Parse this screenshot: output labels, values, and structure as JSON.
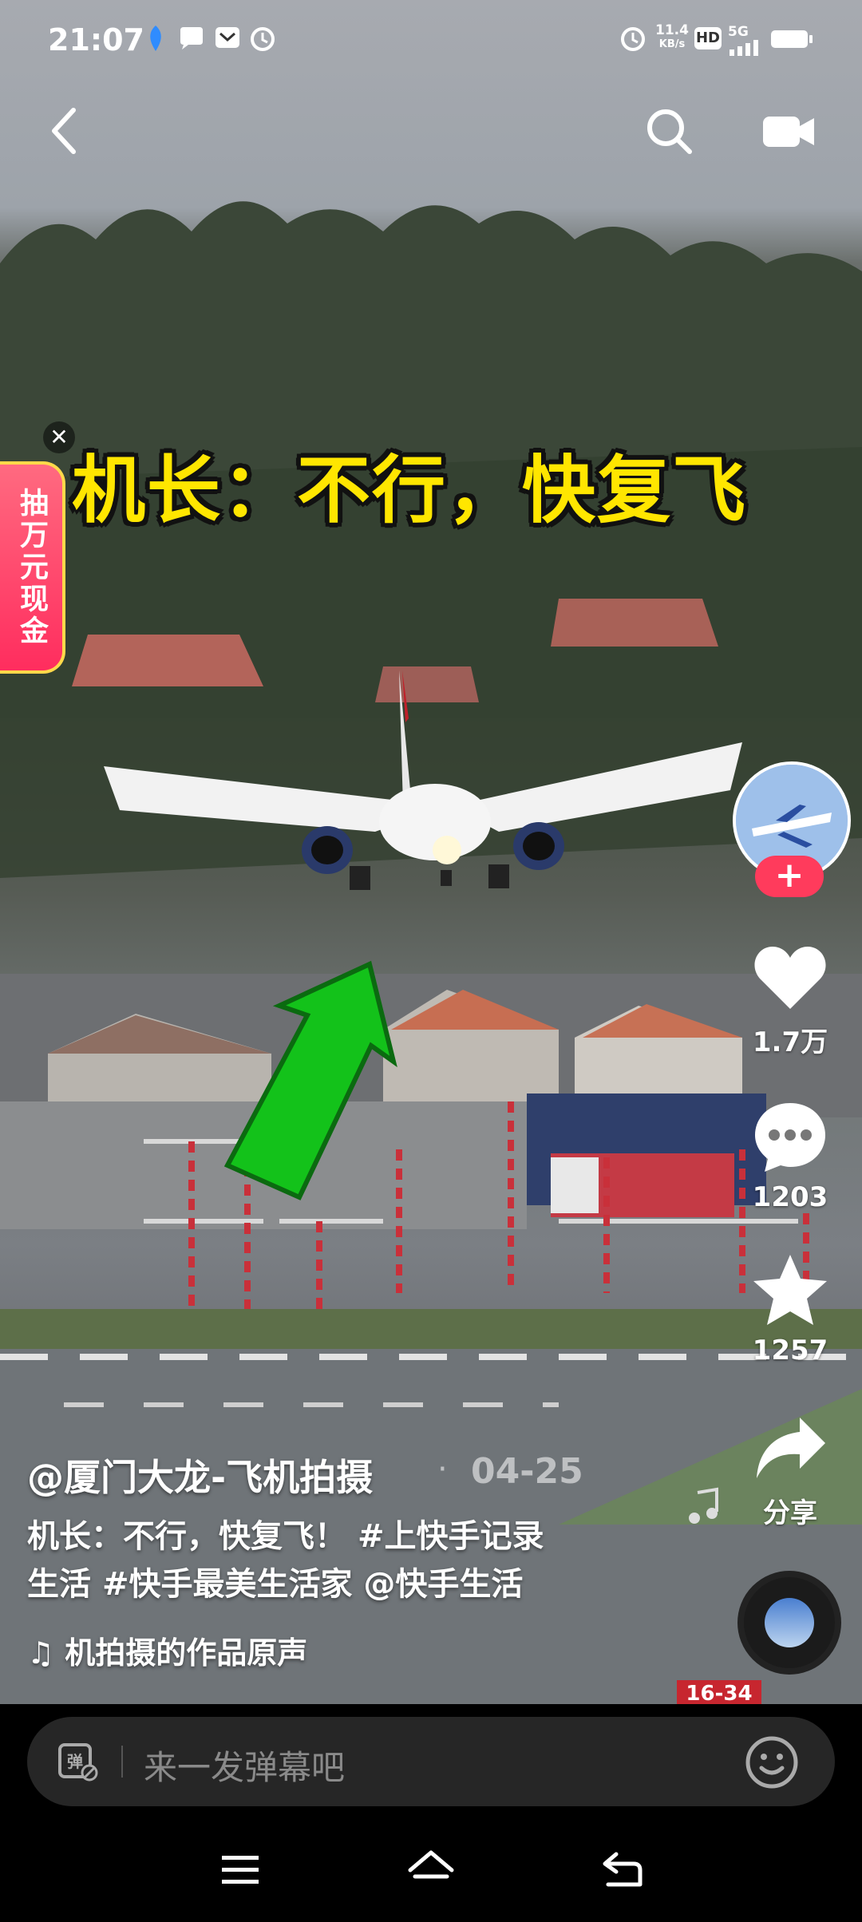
{
  "status_bar": {
    "time": "21:07",
    "network_speed": "11.4",
    "network_unit": "KB/s",
    "hd": "HD",
    "signal": "5G"
  },
  "overlay": {
    "headline": "机长：不行，快复飞",
    "promo": "抽万元现金"
  },
  "rail": {
    "likes": "1.7万",
    "comments": "1203",
    "favorites": "1257",
    "share_label": "分享"
  },
  "post": {
    "author": "@厦门大龙-飞机拍摄",
    "separator": "·",
    "date": "04-25",
    "caption_text": "机长：不行，快复飞！",
    "tag1": "#上快手记录",
    "tag1_line2": "生活",
    "tag2": "#快手最美生活家",
    "mention": "@快手生活",
    "music": "♫ 机拍摄的作品原声"
  },
  "comment_bar": {
    "placeholder": "来一发弹幕吧"
  },
  "scene": {
    "runway_sign": "16-34"
  },
  "colors": {
    "accent": "#ff3b5c",
    "headline": "#ffe600",
    "arrow": "#13c21a"
  },
  "icons": [
    "back-icon",
    "search-icon",
    "camera-icon",
    "heart-icon",
    "comment-icon",
    "star-icon",
    "share-icon",
    "danmaku-icon",
    "emoji-icon",
    "menu-icon",
    "home-icon",
    "back-nav-icon"
  ]
}
